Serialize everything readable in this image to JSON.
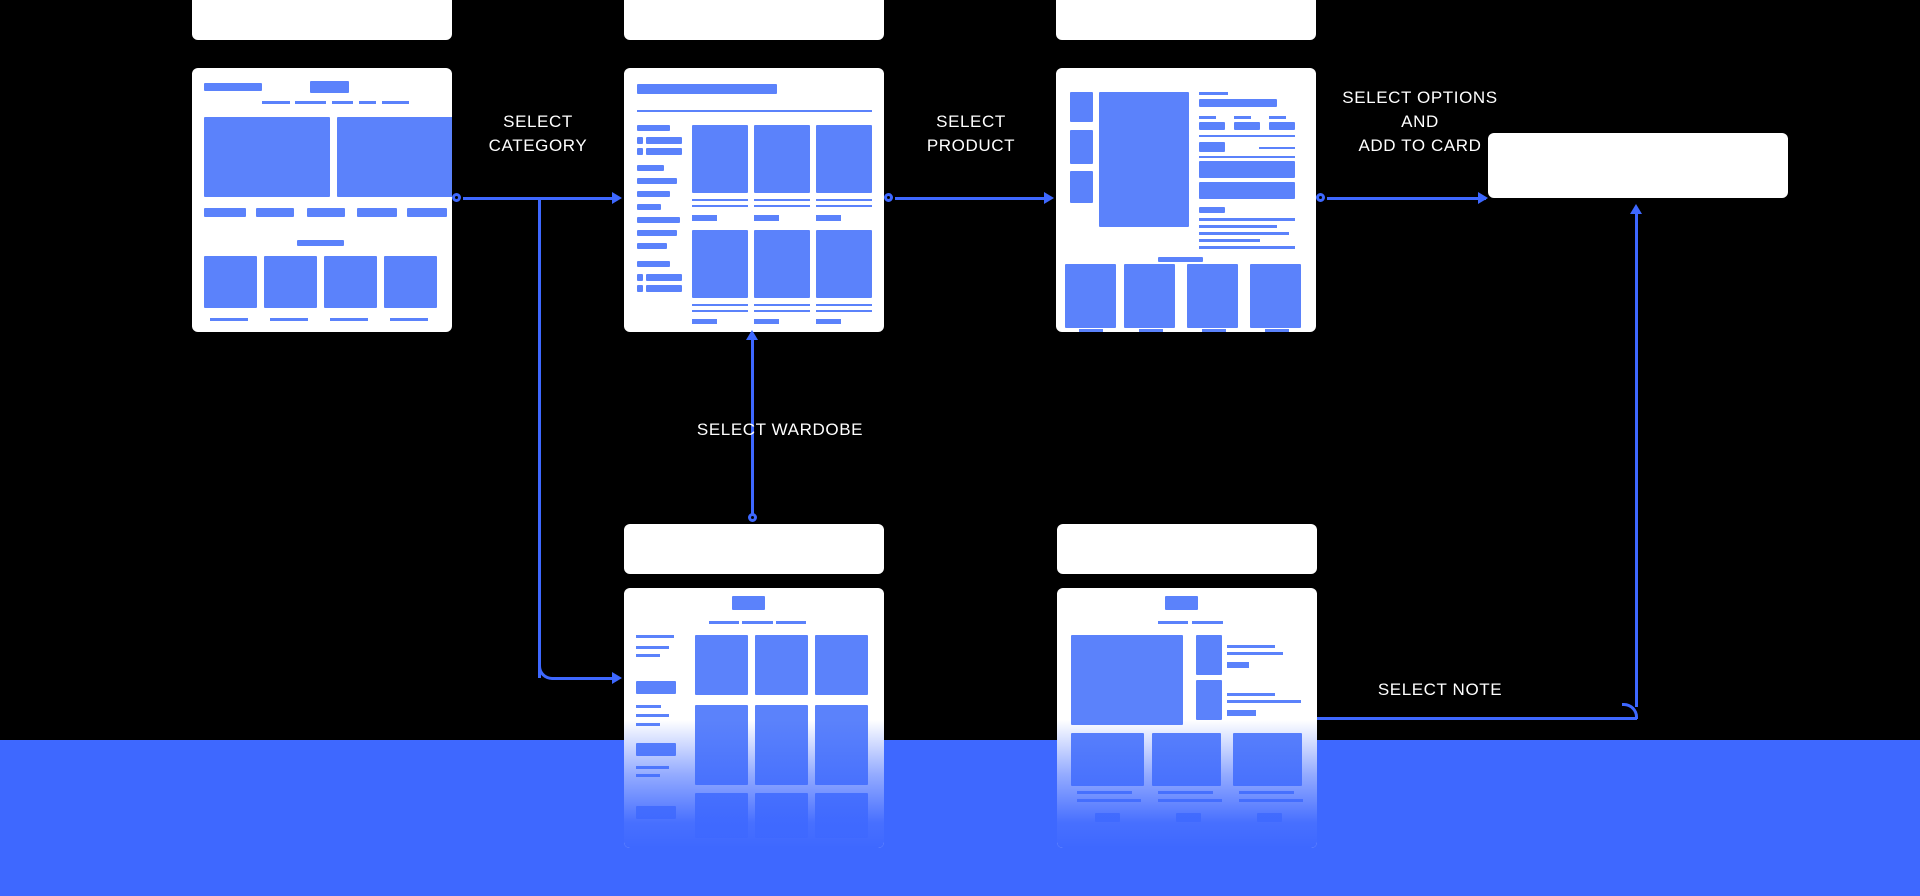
{
  "diagram": {
    "title": "E-commerce user flow wireframe diagram",
    "background_color": "#000000",
    "accent_color": "#3e68ff",
    "wireframe_block_color": "#5b82fb",
    "card_color": "#ffffff",
    "band_color": "#3e68ff"
  },
  "connector_labels": [
    {
      "id": "select-category",
      "text": "SELECT\nCATEGORY"
    },
    {
      "id": "select-product",
      "text": "SELECT\nPRODUCT"
    },
    {
      "id": "select-options",
      "text": "SELECT OPTIONS\nAND\nADD TO CARD"
    },
    {
      "id": "select-wardobe",
      "text": "SELECT WARDOBE"
    },
    {
      "id": "select-note",
      "text": "SELECT NOTE"
    }
  ],
  "screens": [
    {
      "id": "home",
      "header_label": "",
      "body_label": ""
    },
    {
      "id": "category",
      "header_label": "",
      "body_label": ""
    },
    {
      "id": "product-detail",
      "header_label": "",
      "body_label": ""
    },
    {
      "id": "cart",
      "header_label": "",
      "body_label": ""
    },
    {
      "id": "wardrobe",
      "header_label": "",
      "body_label": ""
    },
    {
      "id": "note",
      "header_label": "",
      "body_label": ""
    }
  ]
}
